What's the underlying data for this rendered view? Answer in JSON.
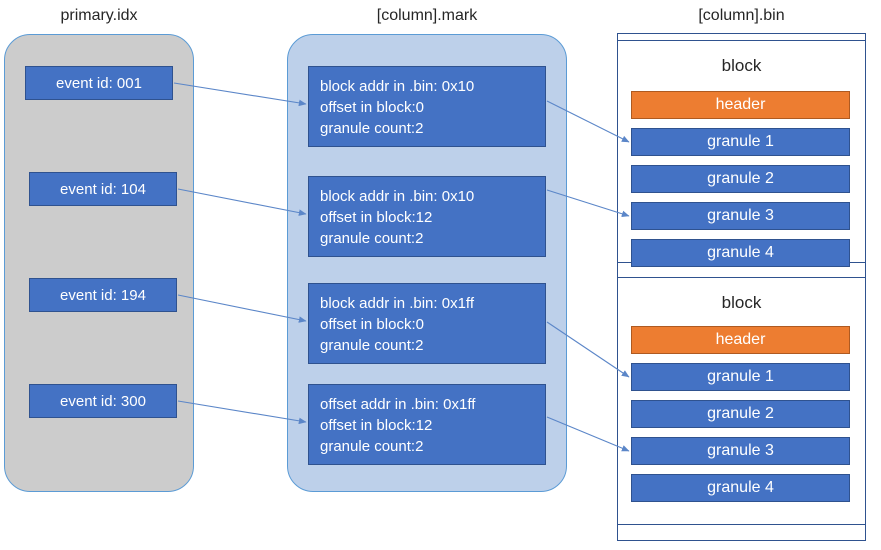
{
  "titles": {
    "idx": "primary.idx",
    "mark": "[column].mark",
    "bin": "[column].bin"
  },
  "idx": {
    "entries": [
      {
        "label": "event id: 001"
      },
      {
        "label": "event id: 104"
      },
      {
        "label": "event id: 194"
      },
      {
        "label": "event id: 300"
      }
    ]
  },
  "mark": {
    "entries": [
      {
        "line1": "block addr in .bin: 0x10",
        "line2": "offset in block:0",
        "line3": "granule count:2"
      },
      {
        "line1": "block addr in .bin: 0x10",
        "line2": "offset in block:12",
        "line3": "granule count:2"
      },
      {
        "line1": "block addr in .bin: 0x1ff",
        "line2": "offset in block:0",
        "line3": "granule count:2"
      },
      {
        "line1": "offset addr in .bin: 0x1ff",
        "line2": "offset in block:12",
        "line3": "granule count:2"
      }
    ]
  },
  "bin": {
    "blocks": [
      {
        "label": "block",
        "header": "header",
        "granules": [
          "granule 1",
          "granule 2",
          "granule 3",
          "granule 4"
        ]
      },
      {
        "label": "block",
        "header": "header",
        "granules": [
          "granule 1",
          "granule 2",
          "granule 3",
          "granule 4"
        ]
      }
    ]
  },
  "colors": {
    "blue_fill": "#4472c4",
    "blue_stroke": "#2f528f",
    "orange_fill": "#ed7d31",
    "gray_container": "#cccccc",
    "lightblue_container": "#bdd0ea",
    "container_border": "#5b9bd5",
    "connector": "#5b86c8",
    "text_dark": "#262626",
    "text_light": "#ffffff",
    "background": "#ffffff"
  }
}
